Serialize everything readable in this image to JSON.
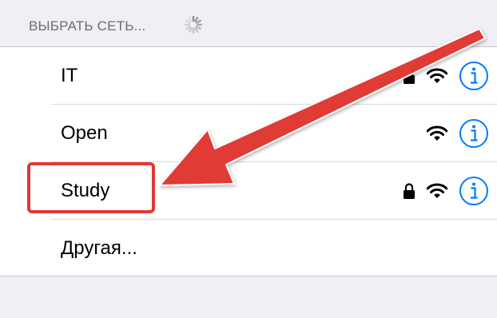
{
  "header": {
    "title": "ВЫБРАТЬ СЕТЬ..."
  },
  "networks": [
    {
      "name": "IT",
      "secured": true,
      "icons": [
        "lock-icon",
        "wifi-icon",
        "info-icon"
      ]
    },
    {
      "name": "Open",
      "secured": false,
      "icons": [
        "wifi-icon",
        "info-icon"
      ]
    },
    {
      "name": "Study",
      "secured": true,
      "icons": [
        "lock-icon",
        "wifi-icon",
        "info-icon"
      ]
    }
  ],
  "other": {
    "label": "Другая..."
  },
  "colors": {
    "accent": "#007aff",
    "annotation": "#e03a35",
    "background": "#efeff4"
  }
}
